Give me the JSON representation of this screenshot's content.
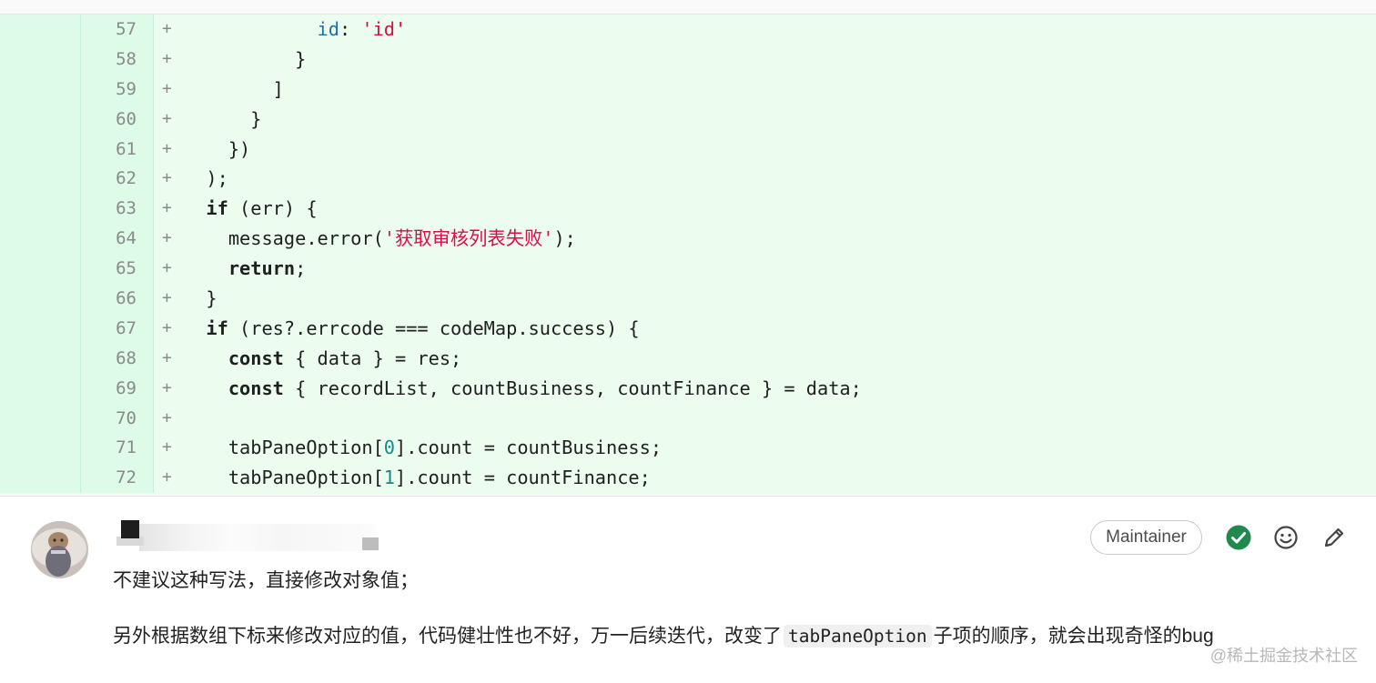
{
  "diff": {
    "lines": [
      {
        "num": "57",
        "sign": "+",
        "tokens": [
          {
            "t": "            "
          },
          {
            "t": "id",
            "c": "prop"
          },
          {
            "t": ": "
          },
          {
            "t": "'id'",
            "c": "str"
          }
        ]
      },
      {
        "num": "58",
        "sign": "+",
        "tokens": [
          {
            "t": "          }"
          }
        ]
      },
      {
        "num": "59",
        "sign": "+",
        "tokens": [
          {
            "t": "        ]"
          }
        ]
      },
      {
        "num": "60",
        "sign": "+",
        "tokens": [
          {
            "t": "      }"
          }
        ]
      },
      {
        "num": "61",
        "sign": "+",
        "tokens": [
          {
            "t": "    })"
          }
        ]
      },
      {
        "num": "62",
        "sign": "+",
        "tokens": [
          {
            "t": "  );"
          }
        ]
      },
      {
        "num": "63",
        "sign": "+",
        "tokens": [
          {
            "t": "  "
          },
          {
            "t": "if",
            "c": "kw"
          },
          {
            "t": " (err) {"
          }
        ]
      },
      {
        "num": "64",
        "sign": "+",
        "tokens": [
          {
            "t": "    message.error("
          },
          {
            "t": "'获取审核列表失败'",
            "c": "str"
          },
          {
            "t": ");"
          }
        ]
      },
      {
        "num": "65",
        "sign": "+",
        "tokens": [
          {
            "t": "    "
          },
          {
            "t": "return",
            "c": "kw"
          },
          {
            "t": ";"
          }
        ]
      },
      {
        "num": "66",
        "sign": "+",
        "tokens": [
          {
            "t": "  }"
          }
        ]
      },
      {
        "num": "67",
        "sign": "+",
        "tokens": [
          {
            "t": "  "
          },
          {
            "t": "if",
            "c": "kw"
          },
          {
            "t": " (res?.errcode === codeMap.success) {"
          }
        ]
      },
      {
        "num": "68",
        "sign": "+",
        "tokens": [
          {
            "t": "    "
          },
          {
            "t": "const",
            "c": "kw"
          },
          {
            "t": " { data } = res;"
          }
        ]
      },
      {
        "num": "69",
        "sign": "+",
        "tokens": [
          {
            "t": "    "
          },
          {
            "t": "const",
            "c": "kw"
          },
          {
            "t": " { recordList, countBusiness, countFinance } = data;"
          }
        ]
      },
      {
        "num": "70",
        "sign": "+",
        "tokens": [
          {
            "t": ""
          }
        ]
      },
      {
        "num": "71",
        "sign": "+",
        "tokens": [
          {
            "t": "    tabPaneOption["
          },
          {
            "t": "0",
            "c": "num"
          },
          {
            "t": "].count = countBusiness;"
          }
        ]
      },
      {
        "num": "72",
        "sign": "+",
        "tokens": [
          {
            "t": "    tabPaneOption["
          },
          {
            "t": "1",
            "c": "num"
          },
          {
            "t": "].count = countFinance;"
          }
        ]
      }
    ]
  },
  "comment": {
    "role_badge": "Maintainer",
    "line1": "不建议这种写法，直接修改对象值；",
    "line2_before": "另外根据数组下标来修改对应的值，代码健壮性也不好，万一后续迭代，改变了",
    "line2_code": "tabPaneOption",
    "line2_after": "子项的顺序，就会出现奇怪的bug",
    "icons": {
      "resolve": "check-circle-icon",
      "reaction": "smiley-icon",
      "edit": "pencil-icon"
    }
  },
  "colors": {
    "resolve": "#1f8a4c",
    "added_bg": "#ecfdf0",
    "string": "#d6104a"
  },
  "watermark": "@稀土掘金技术社区"
}
